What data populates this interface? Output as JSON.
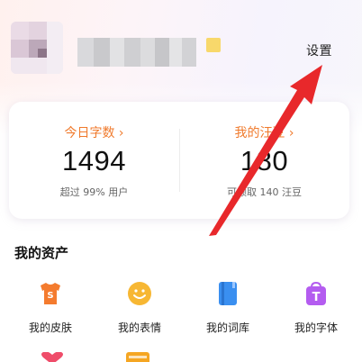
{
  "header": {
    "settings_label": "设置"
  },
  "stats": {
    "characters": {
      "title": "今日字数",
      "value": "1494",
      "subtitle": "超过 99% 用户"
    },
    "beans": {
      "title": "我的汪豆",
      "value": "180",
      "subtitle": "可领取 140 汪豆"
    }
  },
  "assets": {
    "title": "我的资产",
    "items": [
      {
        "label": "我的皮肤",
        "icon": "skin-shirt-icon",
        "color": "#f47b2e"
      },
      {
        "label": "我的表情",
        "icon": "emoji-smile-icon",
        "color": "#f7b733"
      },
      {
        "label": "我的词库",
        "icon": "dictionary-book-icon",
        "color": "#3a8ff0"
      },
      {
        "label": "我的字体",
        "icon": "font-bag-icon",
        "color": "#b45cf0"
      }
    ]
  },
  "colors": {
    "accent": "#f07a2c",
    "arrow": "#e8282b"
  }
}
